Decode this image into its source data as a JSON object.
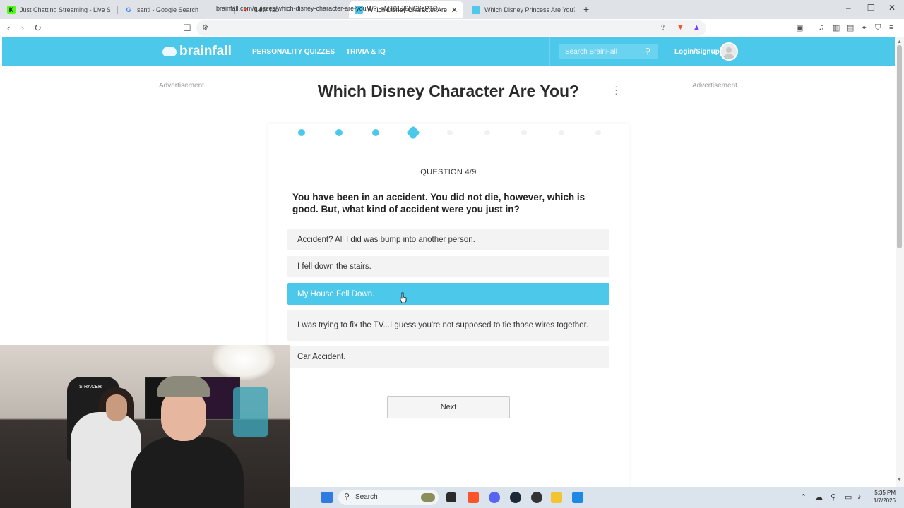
{
  "browser": {
    "tabs": [
      {
        "title": "Just Chatting Streaming - Live Strea",
        "favicon": "kick-icon",
        "color": "#53fc18"
      },
      {
        "title": "santi - Google Search",
        "favicon": "google-icon",
        "color": "#4285f4"
      },
      {
        "title": "New Tab",
        "favicon": "brave-icon",
        "color": "#fb542b"
      },
      {
        "title": "Which Disney Character Are You",
        "favicon": "brainfall-icon",
        "color": "#4cc8ea"
      },
      {
        "title": "Which Disney Princess Are You? | Bra",
        "favicon": "brainfall-icon",
        "color": "#4cc8ea"
      }
    ],
    "active_tab": 3,
    "url": "brainfall.com/quizzes/which-disney-character-are-you/4/?_=MT01Jl9NSYzPTQ"
  },
  "site": {
    "logo": "brainfall",
    "nav": [
      "PERSONALITY QUIZZES",
      "TRIVIA & IQ"
    ],
    "search_placeholder": "Search BrainFall",
    "login": "Login/Signup",
    "accent": "#4cc8ea"
  },
  "page": {
    "advert_left": "Advertisement",
    "advert_right": "Advertisement",
    "title": "Which Disney Character Are You?",
    "progress": {
      "current": 4,
      "total": 9
    },
    "question_number": "QUESTION 4/9",
    "question": "You have been in an accident. You did not die, however, which is good. But, what kind of accident were you just in?",
    "answers": [
      "Accident? All I did was bump into another person.",
      "I fell down the stairs.",
      "My House Fell Down.",
      "I was trying to fix the TV...I guess you're not supposed to tie those wires together.",
      "Car Accident."
    ],
    "selected_answer": 2,
    "next_label": "Next"
  },
  "taskbar": {
    "search_label": "Search",
    "time": "5:35 PM",
    "date": "1/7/2026"
  }
}
